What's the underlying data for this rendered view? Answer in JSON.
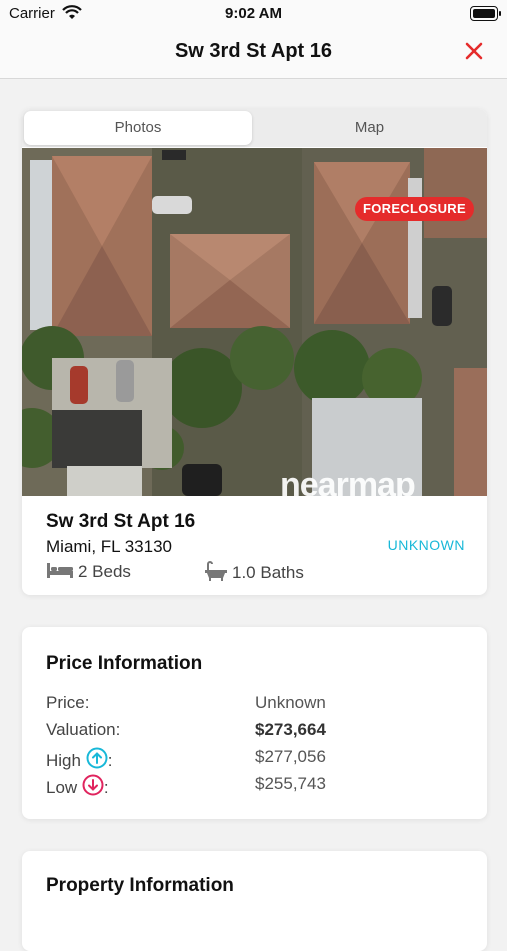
{
  "status_bar": {
    "carrier": "Carrier",
    "time": "9:02 AM"
  },
  "nav": {
    "title": "Sw 3rd St Apt 16",
    "close_icon": "close-icon"
  },
  "tabs": [
    {
      "label": "Photos",
      "selected": true
    },
    {
      "label": "Map",
      "selected": false
    }
  ],
  "photo": {
    "badge": "FORECLOSURE",
    "watermark": "nearmap"
  },
  "listing": {
    "title": "Sw 3rd St Apt 16",
    "city": "Miami, FL 33130",
    "status": "UNKNOWN",
    "beds": "2 Beds",
    "baths": "1.0 Baths"
  },
  "price_info": {
    "title": "Price Information",
    "rows": [
      {
        "label": "Price:",
        "value": "Unknown"
      },
      {
        "label": "Valuation:",
        "value": "$273,664"
      },
      {
        "label": "High",
        "suffix": ":",
        "value": "$277,056"
      },
      {
        "label": "Low",
        "suffix": ":",
        "value": "$255,743"
      }
    ]
  },
  "property_info": {
    "title": "Property Information"
  },
  "colors": {
    "accent": "#18b8d8",
    "close": "#e52b2b",
    "badge": "#e52b2b",
    "high_icon": "#18b8d8",
    "low_icon": "#e0245e"
  }
}
